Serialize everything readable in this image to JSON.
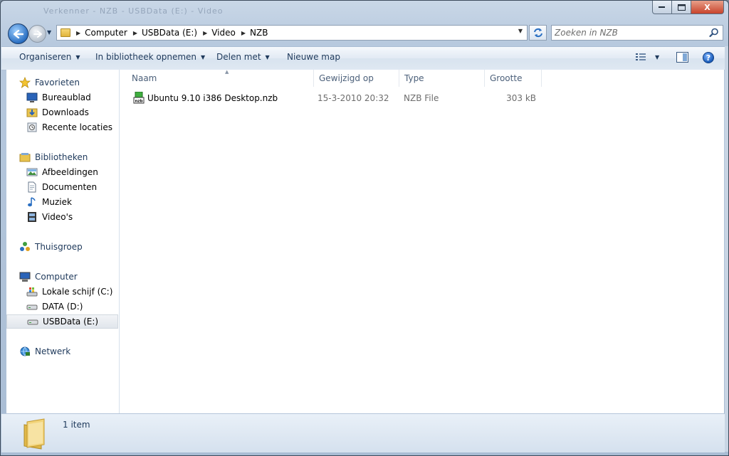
{
  "window": {
    "ghost_title": "Verkenner - NZB - USBData (E:) - Video",
    "controls": {
      "minimize": "▁",
      "maximize": "□",
      "close": "X"
    }
  },
  "navigation": {
    "breadcrumbs": [
      "Computer",
      "USBData (E:)",
      "Video",
      "NZB"
    ],
    "search_placeholder": "Zoeken in NZB"
  },
  "toolbar": {
    "organize": "Organiseren",
    "include_library": "In bibliotheek opnemen",
    "share": "Delen met",
    "new_folder": "Nieuwe map",
    "help": "?"
  },
  "sidebar": {
    "favorites": {
      "label": "Favorieten",
      "items": [
        "Bureaublad",
        "Downloads",
        "Recente locaties"
      ]
    },
    "libraries": {
      "label": "Bibliotheken",
      "items": [
        "Afbeeldingen",
        "Documenten",
        "Muziek",
        "Video's"
      ]
    },
    "homegroup": {
      "label": "Thuisgroep"
    },
    "computer": {
      "label": "Computer",
      "items": [
        "Lokale schijf (C:)",
        "DATA (D:)",
        "USBData (E:)"
      ],
      "selected": "USBData (E:)"
    },
    "network": {
      "label": "Netwerk"
    }
  },
  "columns": {
    "name": "Naam",
    "modified": "Gewijzigd op",
    "type": "Type",
    "size": "Grootte"
  },
  "files": [
    {
      "name": "Ubuntu 9.10 i386 Desktop.nzb",
      "modified": "15-3-2010 20:32",
      "type": "NZB File",
      "size": "303 kB",
      "icon": "nzb-file-icon"
    }
  ],
  "status": {
    "count": "1 item"
  }
}
